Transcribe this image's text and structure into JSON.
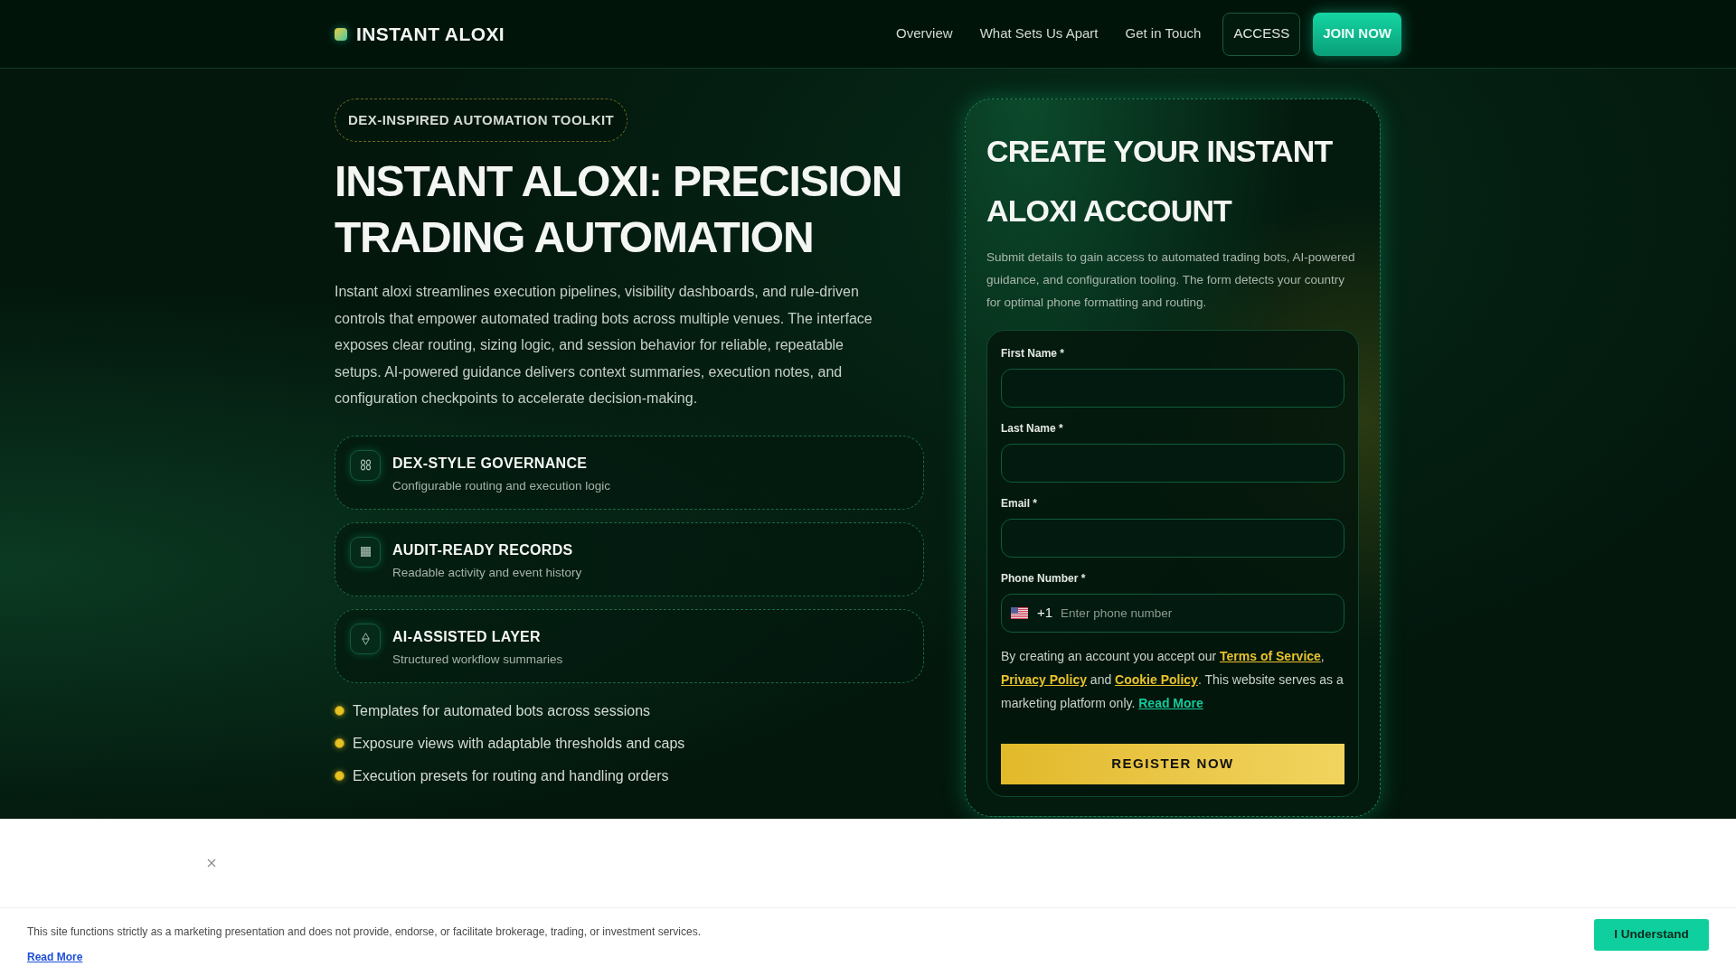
{
  "header": {
    "logo": "INSTANT ALOXI",
    "nav": [
      "Overview",
      "What Sets Us Apart",
      "Get in Touch"
    ],
    "buttons": [
      {
        "label": "ACCESS",
        "kind": "outline"
      },
      {
        "label": "JOIN NOW",
        "kind": "filled"
      }
    ]
  },
  "hero": {
    "badge": "DEX-INSPIRED AUTOMATION TOOLKIT",
    "title": "INSTANT ALOXI: PRECISION TRADING AUTOMATION",
    "description": "Instant aloxi streamlines execution pipelines, visibility dashboards, and rule-driven controls that empower automated trading bots across multiple venues. The interface exposes clear routing, sizing logic, and session behavior for reliable, repeatable setups. AI-powered guidance delivers context summaries, execution notes, and configuration checkpoints to accelerate decision-making.",
    "features": [
      {
        "title": "DEX-STYLE GOVERNANCE",
        "subtitle": "Configurable routing and execution logic"
      },
      {
        "title": "AUDIT-READY RECORDS",
        "subtitle": "Readable activity and event history"
      },
      {
        "title": "AI-ASSISTED LAYER",
        "subtitle": "Structured workflow summaries"
      }
    ],
    "bullets": [
      "Templates for automated bots across sessions",
      "Exposure views with adaptable thresholds and caps",
      "Execution presets for routing and handling orders"
    ]
  },
  "signup": {
    "title": "CREATE YOUR INSTANT ALOXI ACCOUNT",
    "description": "Submit details to gain access to automated trading bots, AI-powered guidance, and configuration tooling. The form detects your country for optimal phone formatting and routing.",
    "fields": [
      {
        "label": "First Name *",
        "kind": "text"
      },
      {
        "label": "Last Name *",
        "kind": "text"
      },
      {
        "label": "Email *",
        "kind": "text"
      },
      {
        "label": "Phone Number *",
        "kind": "phone",
        "dial_code": "+1",
        "placeholder": "Enter phone number"
      }
    ],
    "consent": [
      {
        "kind": "text",
        "text": "By creating an account you accept our "
      },
      {
        "kind": "link",
        "text": "Terms of Service"
      },
      {
        "kind": "text",
        "text": ", "
      },
      {
        "kind": "link",
        "text": "Privacy Policy"
      },
      {
        "kind": "text",
        "text": " and "
      },
      {
        "kind": "link",
        "text": "Cookie Policy"
      },
      {
        "kind": "text",
        "text": ". This website serves as a marketing platform only. "
      },
      {
        "kind": "more",
        "text": "Read More"
      }
    ],
    "submit": "REGISTER NOW"
  },
  "notice": {
    "text": "This site functions strictly as a marketing presentation and does not provide, endorse, or facilitate brokerage, trading, or investment services.",
    "link": "Read More",
    "button": "I Understand"
  }
}
